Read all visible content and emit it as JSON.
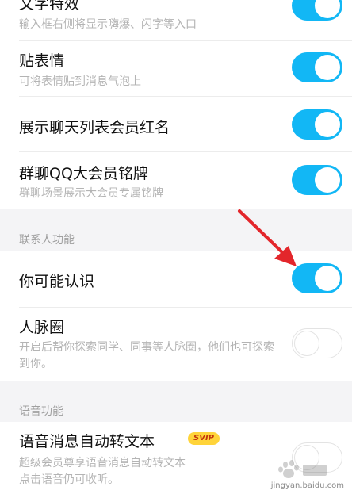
{
  "rows": {
    "text_effects": {
      "title": "文字特效",
      "subtitle": "输入框右侧将显示嗨爆、闪字等入口"
    },
    "sticker": {
      "title": "贴表情",
      "subtitle": "可将表情贴到消息气泡上"
    },
    "vip_red_name": {
      "title": "展示聊天列表会员红名"
    },
    "group_qq_badge": {
      "title": "群聊QQ大会员铭牌",
      "subtitle": "群聊场景展示大会员专属铭牌"
    },
    "may_know": {
      "title": "你可能认识"
    },
    "network_circle": {
      "title": "人脉圈",
      "subtitle": "开启后帮你探索同学、同事等人脉圈，他们也可探索到你。"
    },
    "voice_to_text": {
      "title": "语音消息自动转文本",
      "badge": "SVIP",
      "subtitle_line1": "超级会员尊享语音消息自动转文本",
      "subtitle_line2": "点击语音仍可收听。"
    }
  },
  "sections": {
    "contacts": "联系人功能",
    "voice": "语音功能"
  },
  "toggles": {
    "text_effects": true,
    "sticker": true,
    "vip_red_name": true,
    "group_qq_badge": true,
    "may_know": true,
    "network_circle": false,
    "voice_to_text": false
  },
  "colors": {
    "toggle_on": "#12b7f5",
    "arrow": "#e3262b",
    "badge_bg": "#ffd43a"
  },
  "watermark": {
    "text": "jingyan.baidu.com"
  }
}
